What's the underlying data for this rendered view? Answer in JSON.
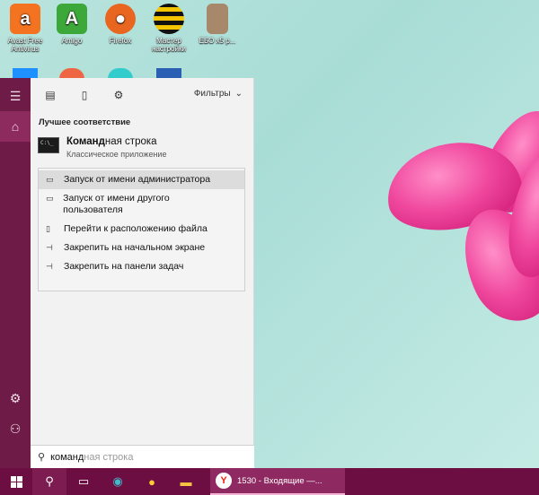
{
  "desktop": {
    "icons": [
      {
        "label": "Avast Free Antivirus",
        "color": "#f47321",
        "glyph": "a"
      },
      {
        "label": "Amigo",
        "color": "#3ca83a",
        "glyph": "A"
      },
      {
        "label": "Firefox",
        "color": "#e8661f",
        "glyph": "🦊"
      },
      {
        "label": "Мастер настройки",
        "color": "#f2c500",
        "glyph": "≡"
      },
      {
        "label": "ЕБО х5 р...",
        "color": "#a7886a",
        "glyph": "▣"
      }
    ]
  },
  "start_rail": {
    "hamburger_icon": "hamburger-icon",
    "home_icon": "home-icon",
    "settings_icon": "gear-icon",
    "user_icon": "person-icon"
  },
  "toolbar": {
    "filters_label": "Фильтры"
  },
  "results": {
    "section_title": "Лучшее соответствие",
    "best_match": {
      "title_bold": "Команд",
      "title_rest": "ная строка",
      "subtitle": "Классическое приложение"
    },
    "context_menu": [
      {
        "label": "Запуск от имени администратора",
        "icon": "shield-icon",
        "highlighted": true
      },
      {
        "label": "Запуск от имени другого пользователя",
        "icon": "user-icon",
        "highlighted": false
      },
      {
        "label": "Перейти к расположению файла",
        "icon": "folder-icon",
        "highlighted": false
      },
      {
        "label": "Закрепить на начальном экране",
        "icon": "pin-icon",
        "highlighted": false
      },
      {
        "label": "Закрепить на панели задач",
        "icon": "pin-icon",
        "highlighted": false
      }
    ]
  },
  "search": {
    "typed": "команд",
    "suggestion": "ная строка"
  },
  "taskbar": {
    "active_app_title": "1530 - Входящие —...",
    "accent_color": "#6d0e43"
  }
}
